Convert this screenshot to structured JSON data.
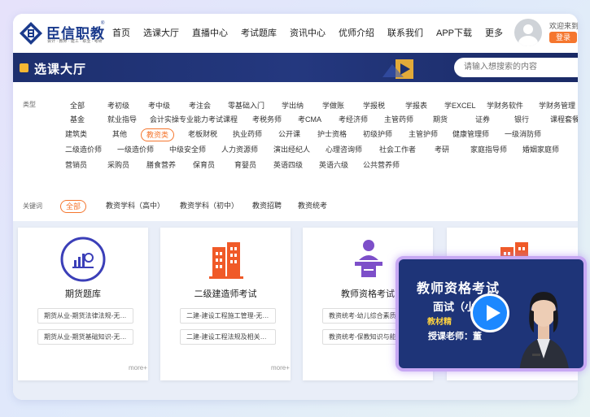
{
  "header": {
    "logo_text": "臣信职教",
    "logo_sub": "会计 · 教师 · 建工 · 职业 · 考研",
    "nav": [
      "首页",
      "选课大厅",
      "直播中心",
      "考试题库",
      "资讯中心",
      "优师介绍",
      "联系我们",
      "APP下载",
      "更多"
    ],
    "welcome": "欢迎来到",
    "login": "登录"
  },
  "banner": {
    "title": "选课大厅",
    "search_placeholder": "请输入想搜索的内容"
  },
  "filters": {
    "type_label": "类型",
    "rows": [
      [
        "全部",
        "考初级",
        "考中级",
        "考注会",
        "零基础入门",
        "学出纳",
        "学做账",
        "学报税",
        "学报表",
        "学EXCEL",
        "学财务软件",
        "学财务管理"
      ],
      [
        "基金",
        "就业指导",
        "会计实操专业能力考试课程",
        "考税务师",
        "考CMA",
        "考经济师",
        "主管药师",
        "期货",
        "证券",
        "银行",
        "课程套餐"
      ],
      [
        "建筑类",
        "其他",
        "教资类",
        "老板财税",
        "执业药师",
        "公开课",
        "护士资格",
        "初级护师",
        "主管护师",
        "健康管理师",
        "一级消防师"
      ],
      [
        "二级造价师",
        "一级造价师",
        "中级安全师",
        "人力资源师",
        "演出经纪人",
        "心理咨询师",
        "社会工作者",
        "考研",
        "家庭指导师",
        "婚姻家庭师"
      ],
      [
        "营销员",
        "采购员",
        "膳食营养",
        "保育员",
        "育婴员",
        "英语四级",
        "英语六级",
        "公共营养师"
      ]
    ],
    "keyword_label": "关键词",
    "keywords": [
      "全部",
      "教资学科（高中）",
      "教资学科（初中）",
      "教资招聘",
      "教资统考"
    ]
  },
  "cards": [
    {
      "title": "期货题库",
      "items": [
        "期货从业-期货法律法规-无…",
        "期货从业-期货基础知识-无…"
      ],
      "more": "more+",
      "icon": "futures-icon"
    },
    {
      "title": "二级建造师考试",
      "items": [
        "二建-建设工程施工管理-无…",
        "二建-建设工程法规及相关…"
      ],
      "more": "more+",
      "icon": "building-icon"
    },
    {
      "title": "教师资格考试",
      "items": [
        "教资统考-幼儿综合素质-无…",
        "教资统考-保教知识与能力…"
      ],
      "more": "",
      "icon": "lecture-icon"
    },
    {
      "title": "",
      "items": [],
      "more": "",
      "icon": "building-icon"
    }
  ],
  "video": {
    "title": "教师资格考试",
    "subtitle": "面试（小",
    "tag": "教材精",
    "teacher": "授课老师：",
    "teacher_name": "董"
  },
  "colors": {
    "accent": "#f5762e",
    "brand": "#1a3a8c",
    "banner": "#1d2f6e",
    "icon_blue": "#3b3fb8",
    "icon_orange": "#f05a28",
    "icon_purple": "#7d4fc9"
  }
}
